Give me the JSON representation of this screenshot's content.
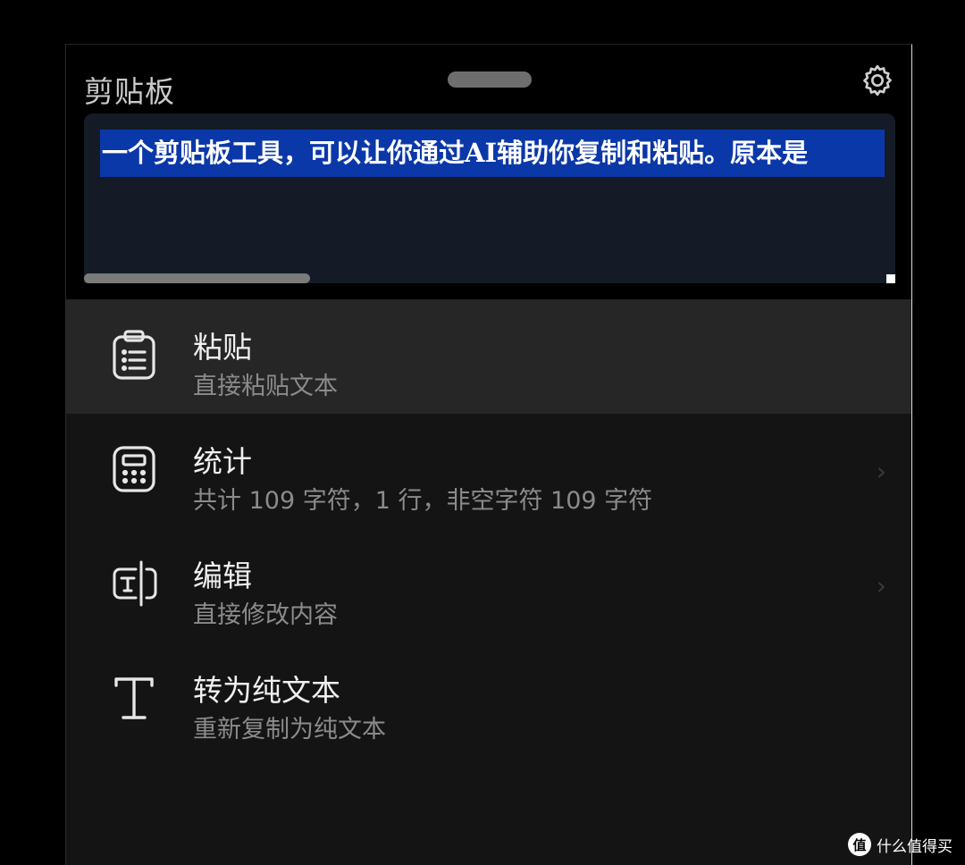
{
  "header": {
    "title": "剪贴板",
    "settings_icon": "gear-icon"
  },
  "clipboard": {
    "selected_text": "一个剪贴板工具，可以让你通过AI辅助你复制和粘贴。原本是"
  },
  "menu": [
    {
      "label": "粘贴",
      "sub": "直接粘贴文本",
      "icon": "clipboard-list-icon"
    },
    {
      "label": "统计",
      "sub": "共计 109 字符，1 行，非空字符 109 字符",
      "icon": "calculator-icon"
    },
    {
      "label": "编辑",
      "sub": "直接修改内容",
      "icon": "text-cursor-icon"
    },
    {
      "label": "转为纯文本",
      "sub": "重新复制为纯文本",
      "icon": "text-type-icon"
    }
  ],
  "watermark": {
    "logo": "值",
    "text": "什么值得买"
  },
  "colors": {
    "background": "#000000",
    "panel": "#141414",
    "selection": "#0b38a8",
    "textbox": "#141b27",
    "active_item": "#262626"
  }
}
